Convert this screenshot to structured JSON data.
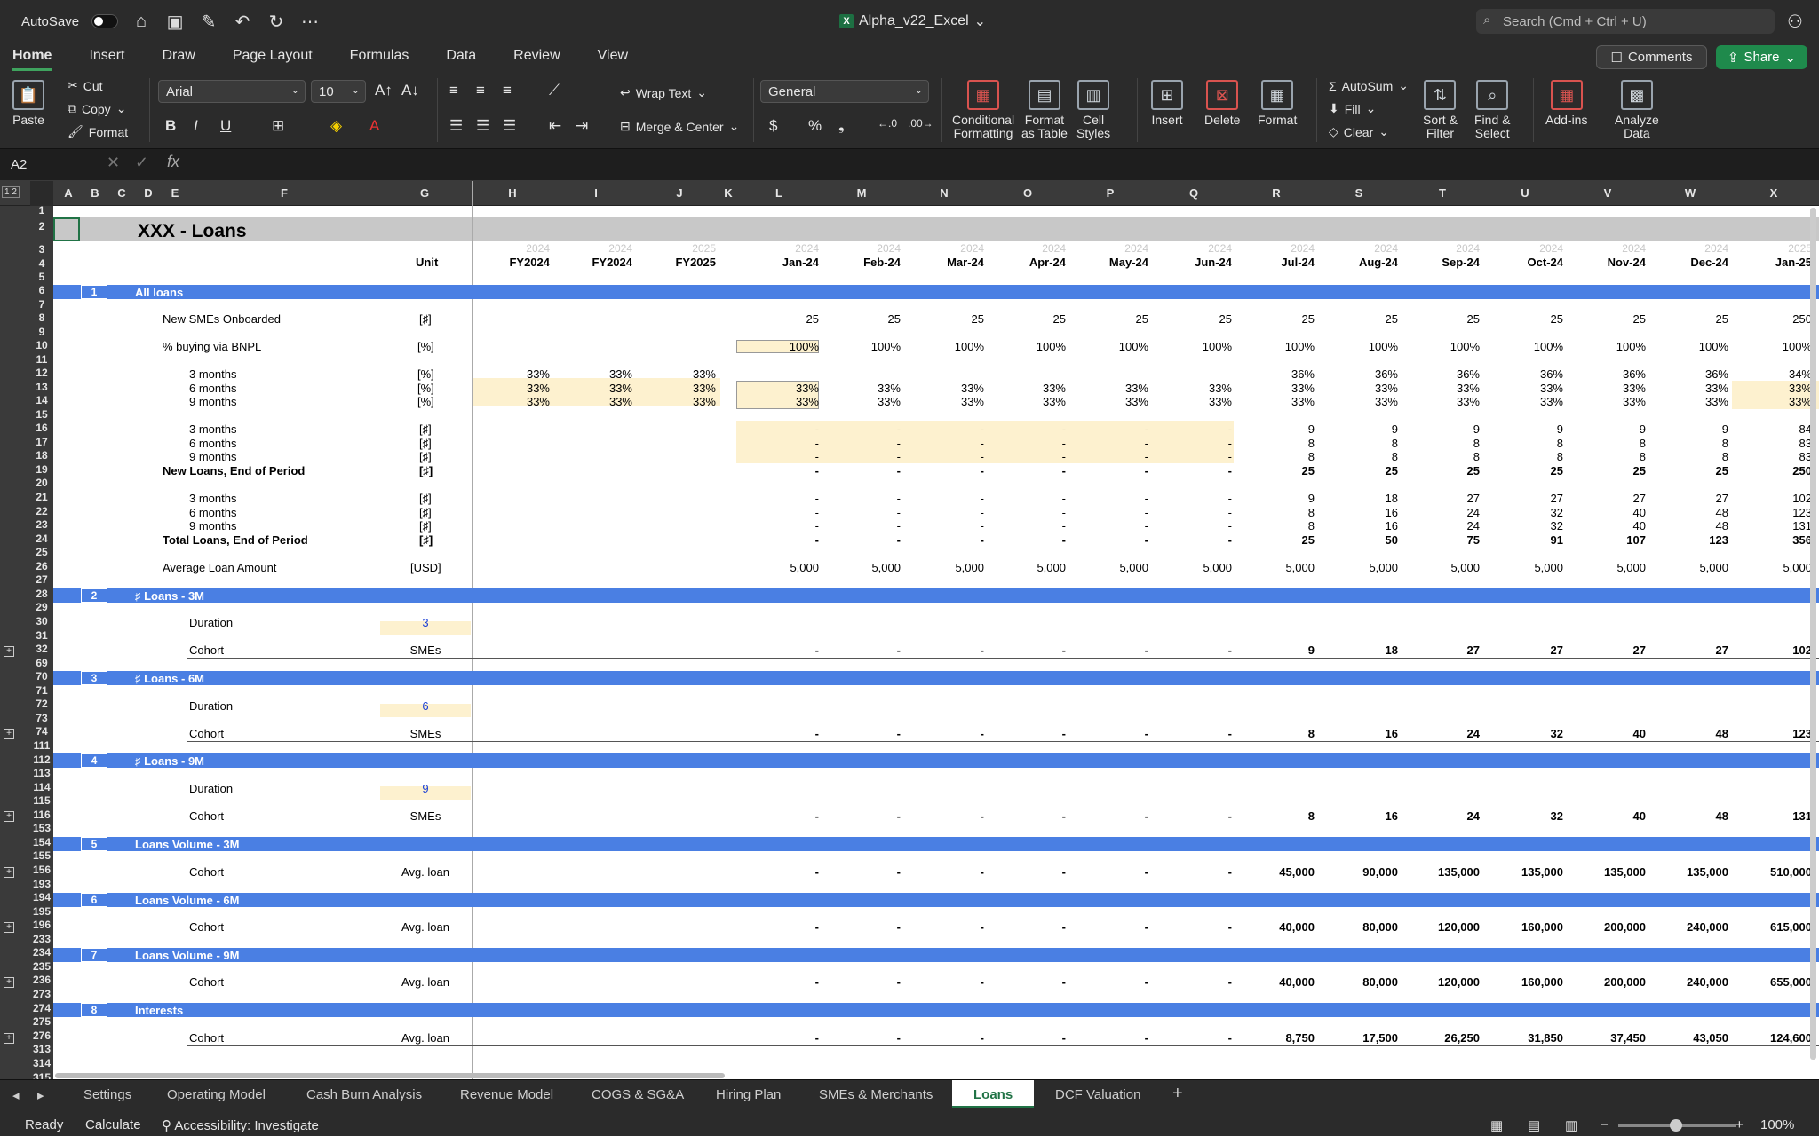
{
  "window": {
    "autosave_label": "AutoSave",
    "title": "Alpha_v22_Excel",
    "search_placeholder": "Search (Cmd + Ctrl + U)"
  },
  "ribbon_tabs": [
    "Home",
    "Insert",
    "Draw",
    "Page Layout",
    "Formulas",
    "Data",
    "Review",
    "View"
  ],
  "buttons": {
    "comments": "Comments",
    "share": "Share"
  },
  "ribbon": {
    "paste": "Paste",
    "cut": "Cut",
    "copy": "Copy",
    "format": "Format",
    "font_name": "Arial",
    "font_size": "10",
    "wrap_text": "Wrap Text",
    "merge_center": "Merge & Center",
    "number_format": "General",
    "conditional": "Conditional\nFormatting",
    "format_table": "Format\nas Table",
    "cell_styles": "Cell\nStyles",
    "insert": "Insert",
    "delete": "Delete",
    "format2": "Format",
    "autosum": "AutoSum",
    "fill": "Fill",
    "clear": "Clear",
    "sort_filter": "Sort &\nFilter",
    "find_select": "Find &\nSelect",
    "addins": "Add-ins",
    "analyze": "Analyze\nData"
  },
  "formula_bar": {
    "namebox": "A2",
    "fx": "fx"
  },
  "col_headers": [
    "A",
    "B",
    "C",
    "D",
    "E",
    "F",
    "G",
    "H",
    "I",
    "J",
    "K",
    "L",
    "M",
    "N",
    "O",
    "P",
    "Q",
    "R",
    "S",
    "T",
    "U",
    "V",
    "W",
    "X"
  ],
  "sheet": {
    "title": "XXX - Loans",
    "unit_header": "Unit",
    "years": [
      "2024",
      "2024",
      "2025",
      "2024",
      "2024",
      "2024",
      "2024",
      "2024",
      "2024",
      "2024",
      "2024",
      "2024",
      "2024",
      "2024",
      "2024",
      "2025"
    ],
    "periods": [
      "FY2024",
      "FY2024",
      "FY2025",
      "Jan-24",
      "Feb-24",
      "Mar-24",
      "Apr-24",
      "May-24",
      "Jun-24",
      "Jul-24",
      "Aug-24",
      "Sep-24",
      "Oct-24",
      "Nov-24",
      "Dec-24",
      "Jan-25"
    ],
    "sections": [
      {
        "num": "1",
        "label": "All loans"
      },
      {
        "num": "2",
        "label": "♯ Loans - 3M"
      },
      {
        "num": "3",
        "label": "♯ Loans - 6M"
      },
      {
        "num": "4",
        "label": "♯ Loans - 9M"
      },
      {
        "num": "5",
        "label": "Loans Volume - 3M"
      },
      {
        "num": "6",
        "label": "Loans Volume - 6M"
      },
      {
        "num": "7",
        "label": "Loans Volume - 9M"
      },
      {
        "num": "8",
        "label": "Interests"
      }
    ]
  },
  "sheet_tabs": [
    "Settings",
    "Operating Model",
    "Cash Burn Analysis",
    "Revenue Model",
    "COGS & SG&A",
    "Hiring Plan",
    "SMEs & Merchants",
    "Loans",
    "DCF Valuation"
  ],
  "status": {
    "ready": "Ready",
    "calculate": "Calculate",
    "accessibility": "Accessibility: Investigate",
    "zoom": "100%"
  }
}
